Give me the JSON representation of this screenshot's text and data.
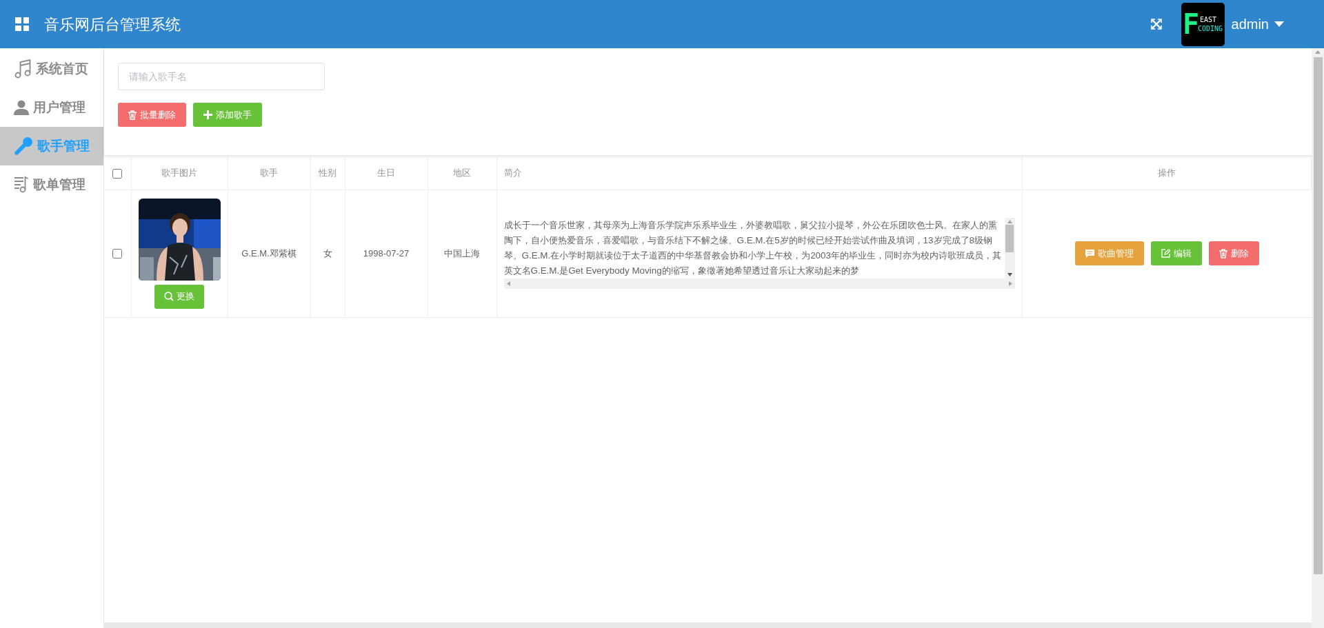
{
  "header": {
    "title": "音乐网后台管理系统",
    "user": "admin",
    "logo": {
      "letter": "F",
      "line_1": "EAST",
      "line_2": "CODING"
    }
  },
  "sidebar": {
    "items": [
      {
        "label": "系统首页",
        "kind": "music",
        "selected": false
      },
      {
        "label": "用户管理",
        "kind": "user",
        "selected": false
      },
      {
        "label": "歌手管理",
        "kind": "mic",
        "selected": true
      },
      {
        "label": "歌单管理",
        "kind": "playlist",
        "selected": false
      }
    ]
  },
  "toolbar": {
    "search": {
      "placeholder": "请输入歌手名"
    },
    "buttons": [
      {
        "label": "批量删除",
        "kind": "danger"
      },
      {
        "label": "添加歌手",
        "kind": "add"
      }
    ]
  },
  "table": {
    "header_checkbox": {
      "checked": false
    },
    "columns": [
      "歌手图片",
      "歌手",
      "性别",
      "生日",
      "地区",
      "简介",
      "操作"
    ],
    "rows": [
      {
        "checked": false,
        "change_button": "更换",
        "singer": "G.E.M.邓紫棋",
        "gender": "女",
        "birthday": "1998-07-27",
        "region": "中国上海",
        "intro": "成长于一个音乐世家，其母亲为上海音乐学院声乐系毕业生，外婆教唱歌，舅父拉小提琴，外公在乐团吹色士风。在家人的熏陶下，自小便热爱音乐，喜爱唱歌，与音乐结下不解之缘。G.E.M.在5岁的时候已经开始尝试作曲及填词，13岁完成了8级钢琴。G.E.M.在小学时期就读位于太子道西的中华基督教会协和小学上午校，为2003年的毕业生，同时亦为校内诗歌班成员，其英文名G.E.M.是Get Everybody Moving的缩写，象徵著她希望透过音乐让大家动起来的梦",
        "actions": [
          {
            "label": "歌曲管理",
            "kind": "songs"
          },
          {
            "label": "编辑",
            "kind": "edit"
          },
          {
            "label": "删除",
            "kind": "delete"
          }
        ]
      }
    ]
  }
}
